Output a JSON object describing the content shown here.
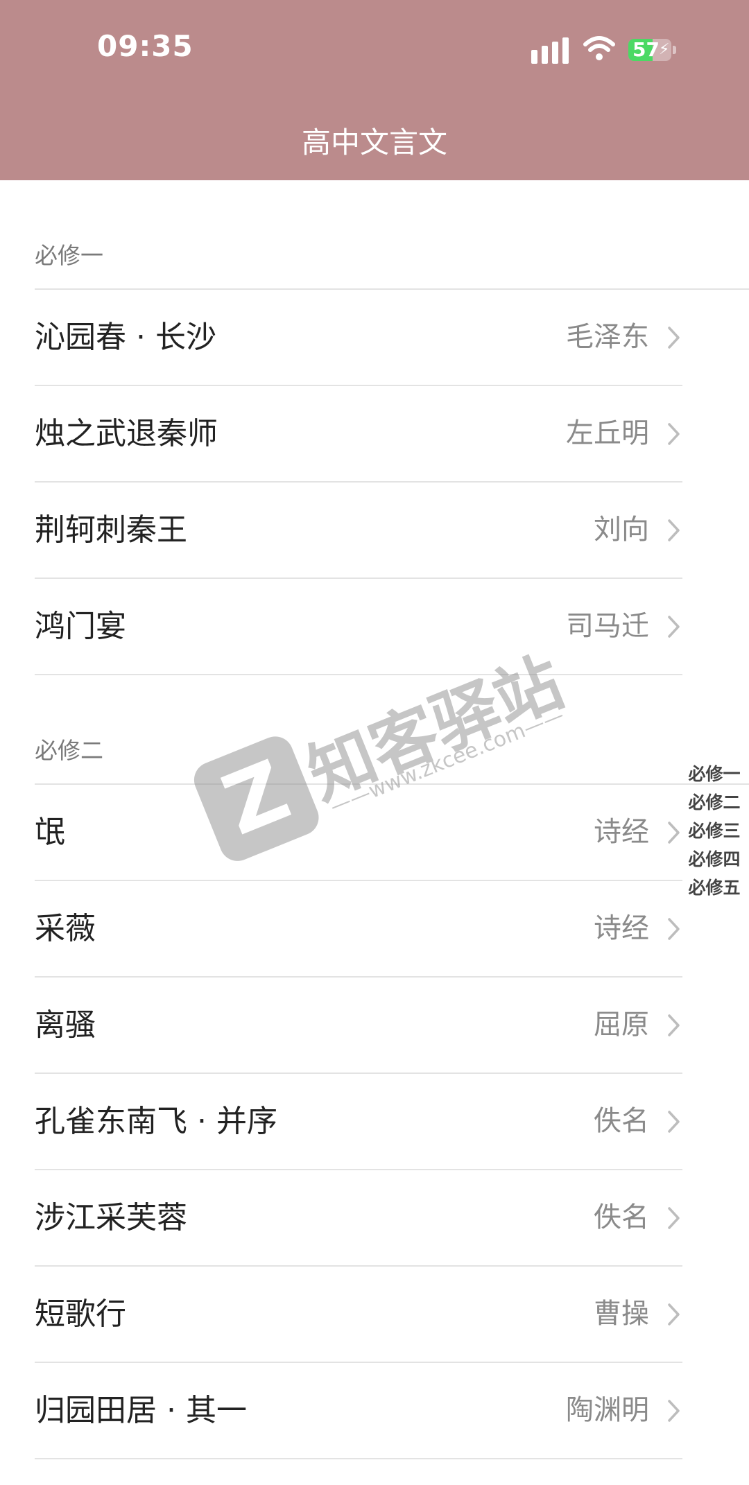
{
  "status_bar": {
    "time": "09:35",
    "battery_level": "57",
    "battery_fraction": 0.57,
    "icons": [
      "signal-icon",
      "wifi-icon",
      "battery-icon"
    ]
  },
  "header": {
    "title": "高中文言文",
    "background_color": "#bb8b8c"
  },
  "sections": [
    {
      "label": "必修一",
      "items": [
        {
          "title": "沁园春 · 长沙",
          "author": "毛泽东"
        },
        {
          "title": "烛之武退秦师",
          "author": "左丘明"
        },
        {
          "title": "荆轲刺秦王",
          "author": "刘向"
        },
        {
          "title": "鸿门宴",
          "author": "司马迁"
        }
      ]
    },
    {
      "label": "必修二",
      "items": [
        {
          "title": "氓",
          "author": "诗经"
        },
        {
          "title": "采薇",
          "author": "诗经"
        },
        {
          "title": "离骚",
          "author": "屈原"
        },
        {
          "title": "孔雀东南飞 · 并序",
          "author": "佚名"
        },
        {
          "title": "涉江采芙蓉",
          "author": "佚名"
        },
        {
          "title": "短歌行",
          "author": "曹操"
        },
        {
          "title": "归园田居 · 其一",
          "author": "陶渊明"
        }
      ]
    }
  ],
  "section_index": [
    "必修一",
    "必修二",
    "必修三",
    "必修四",
    "必修五"
  ],
  "watermark": {
    "logo_letter": "Z",
    "text": "知客驿站",
    "url": "——www.zkcee.com——"
  }
}
